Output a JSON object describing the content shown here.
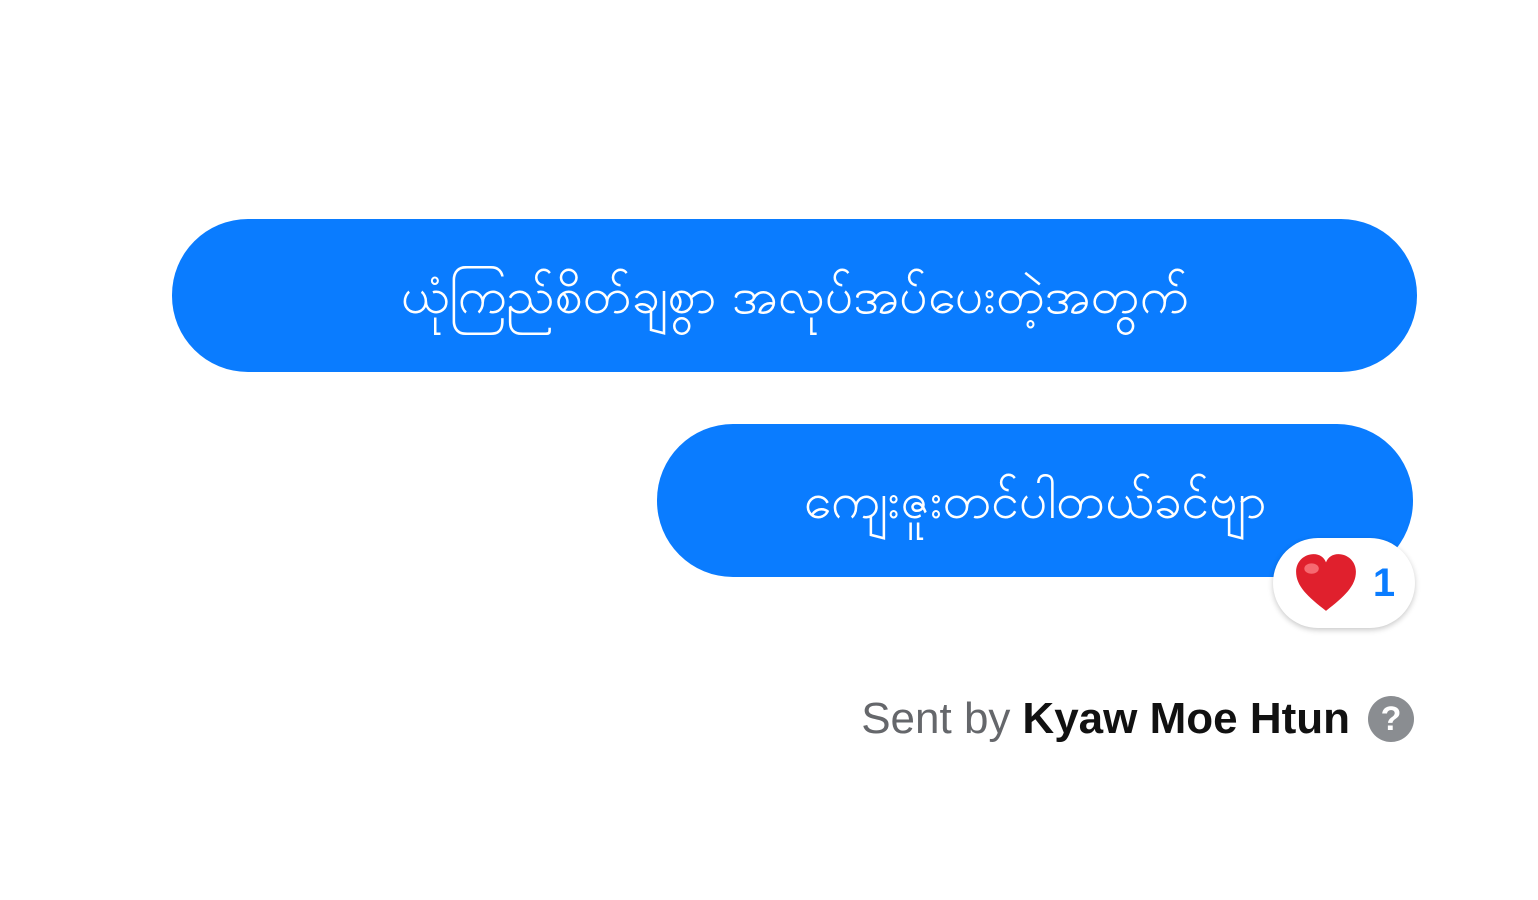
{
  "messages": [
    {
      "text": "ယုံကြည်စိတ်ချစွာ အလုပ်အပ်ပေးတဲ့အတွက်"
    },
    {
      "text": "ကျေးဇူးတင်ပါတယ်ခင်ဗျာ"
    }
  ],
  "reaction": {
    "emoji_icon": "heart-icon",
    "count": "1",
    "color": "#e0202d"
  },
  "footer": {
    "sent_by_prefix": "Sent by",
    "sender_name": "Kyaw Moe Htun",
    "help_glyph": "?"
  },
  "colors": {
    "bubble": "#0a7cff",
    "bubble_text": "#ffffff",
    "count_text": "#0a7cff"
  }
}
